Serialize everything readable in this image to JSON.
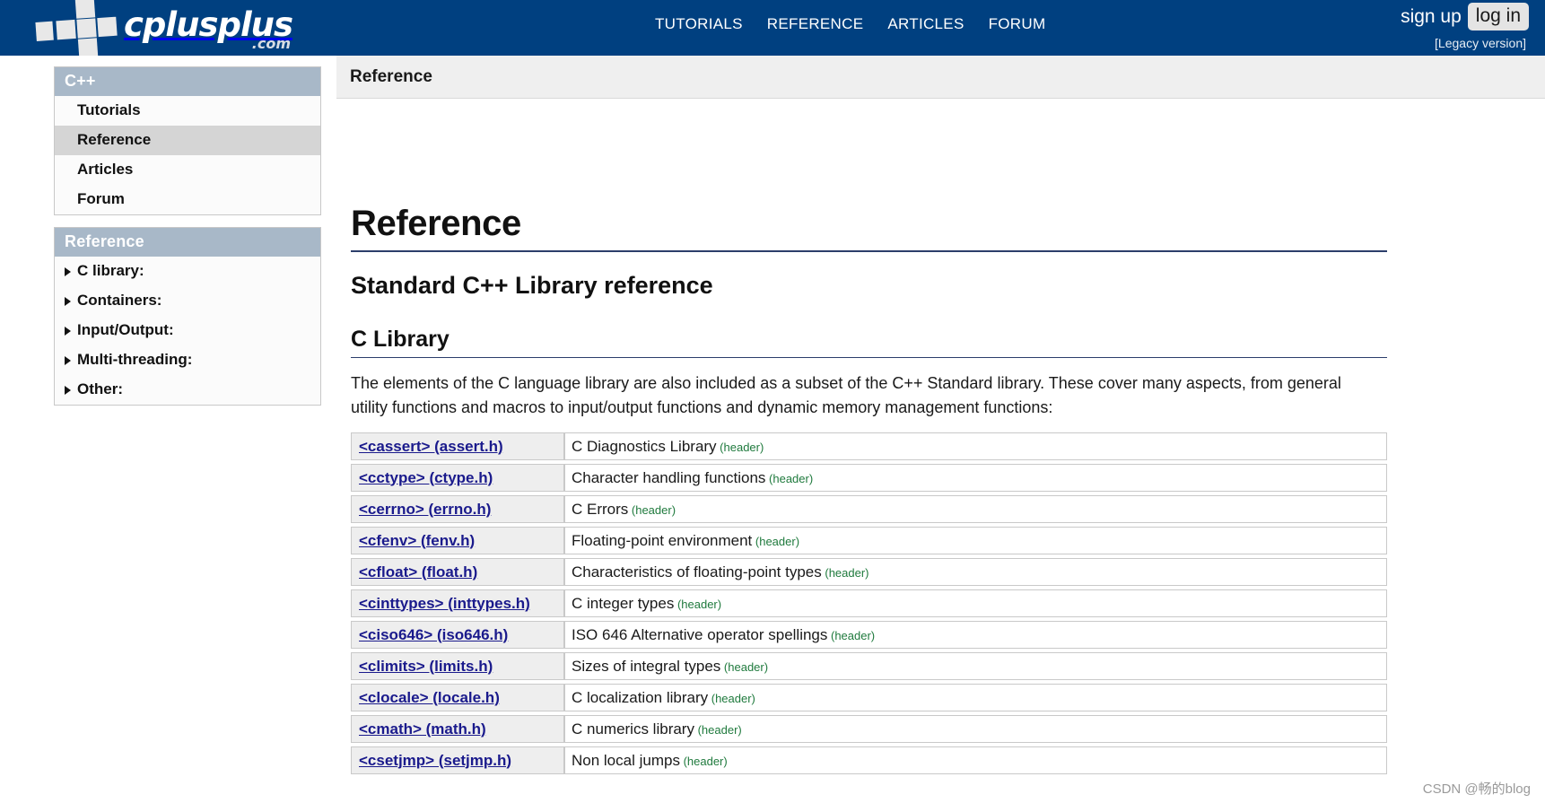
{
  "header": {
    "logo_word": "cplusplus",
    "logo_suffix": ".com",
    "logo_icon": "cross-squares-logo",
    "nav": [
      {
        "label": "TUTORIALS",
        "name": "nav-tutorials"
      },
      {
        "label": "REFERENCE",
        "name": "nav-reference"
      },
      {
        "label": "ARTICLES",
        "name": "nav-articles"
      },
      {
        "label": "FORUM",
        "name": "nav-forum"
      }
    ],
    "sign_up": "sign up",
    "log_in": "log in",
    "legacy": "[Legacy version]",
    "bar_color": "#004080"
  },
  "sidebar": {
    "box1": {
      "title": "C++",
      "items": [
        {
          "label": "Tutorials",
          "active": false
        },
        {
          "label": "Reference",
          "active": true
        },
        {
          "label": "Articles",
          "active": false
        },
        {
          "label": "Forum",
          "active": false
        }
      ]
    },
    "box2": {
      "title": "Reference",
      "items": [
        {
          "label": "C library:"
        },
        {
          "label": "Containers:"
        },
        {
          "label": "Input/Output:"
        },
        {
          "label": "Multi-threading:"
        },
        {
          "label": "Other:"
        }
      ]
    },
    "header_color": "#a8b8c8",
    "active_color": "#d5d5d5"
  },
  "breadcrumb": "Reference",
  "main": {
    "title": "Reference",
    "subtitle": "Standard C++ Library reference",
    "section": "C Library",
    "intro": "The elements of the C language library are also included as a subset of the C++ Standard library. These cover many aspects, from general utility functions and macros to input/output functions and dynamic memory management functions:",
    "header_tag": "(header)",
    "link_color": "#1a1a8c",
    "tag_color": "#1f7a3d",
    "rows": [
      {
        "name": "<cassert> (assert.h)",
        "desc": "C Diagnostics Library"
      },
      {
        "name": "<cctype> (ctype.h)",
        "desc": "Character handling functions"
      },
      {
        "name": "<cerrno> (errno.h)",
        "desc": "C Errors"
      },
      {
        "name": "<cfenv> (fenv.h)",
        "desc": "Floating-point environment"
      },
      {
        "name": "<cfloat> (float.h)",
        "desc": "Characteristics of floating-point types"
      },
      {
        "name": "<cinttypes> (inttypes.h)",
        "desc": "C integer types"
      },
      {
        "name": "<ciso646> (iso646.h)",
        "desc": "ISO 646 Alternative operator spellings"
      },
      {
        "name": "<climits> (limits.h)",
        "desc": "Sizes of integral types"
      },
      {
        "name": "<clocale> (locale.h)",
        "desc": "C localization library"
      },
      {
        "name": "<cmath> (math.h)",
        "desc": "C numerics library"
      },
      {
        "name": "<csetjmp> (setjmp.h)",
        "desc": "Non local jumps"
      }
    ]
  },
  "watermark": "CSDN @畅的blog"
}
